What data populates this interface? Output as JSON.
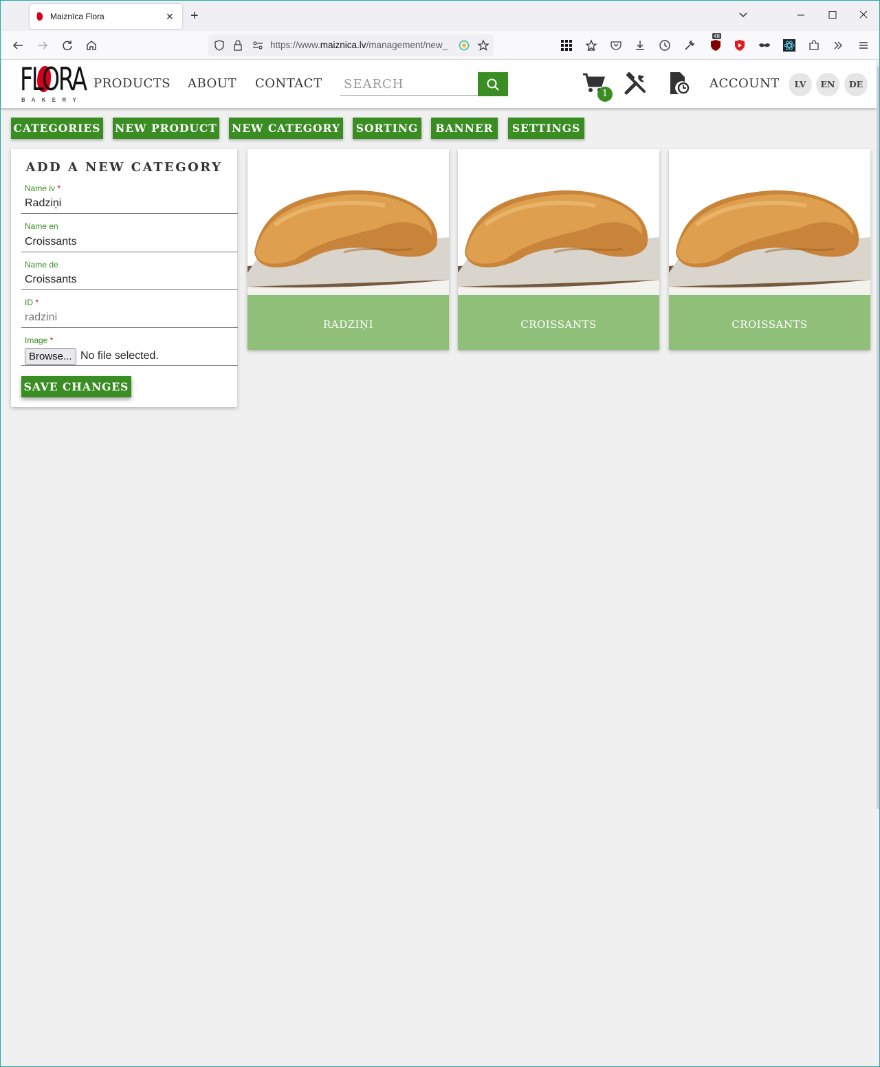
{
  "browser": {
    "tab_title": "Maiznīca Flora",
    "url_prefix": "https://www.",
    "url_domain": "maiznica.lv",
    "url_path": "/management/new_",
    "extension_badge": "48"
  },
  "header": {
    "logo_text": "FLORA",
    "logo_subtitle": "BAKERY",
    "nav": {
      "products": "PRODUCTS",
      "about": "ABOUT",
      "contact": "CONTACT",
      "account": "ACCOUNT"
    },
    "search_placeholder": "SEARCH",
    "cart_count": "1",
    "languages": [
      "LV",
      "EN",
      "DE"
    ]
  },
  "admin_menu": [
    "CATEGORIES",
    "NEW PRODUCT",
    "NEW CATEGORY",
    "SORTING",
    "BANNER",
    "SETTINGS"
  ],
  "form": {
    "title": "ADD A NEW CATEGORY",
    "fields": [
      {
        "label": "Name lv",
        "required": "*",
        "value": "Radziņi"
      },
      {
        "label": "Name en",
        "required": "",
        "value": "Croissants"
      },
      {
        "label": "Name de",
        "required": "",
        "value": "Croissants"
      },
      {
        "label": "ID",
        "required": "*",
        "value": "radzini"
      }
    ],
    "image_label": "Image",
    "image_required": "*",
    "browse_label": "Browse...",
    "file_status": "No file selected.",
    "save_label": "SAVE CHANGES"
  },
  "categories": [
    {
      "name": "RADZIŅI"
    },
    {
      "name": "CROISSANTS"
    },
    {
      "name": "CROISSANTS"
    }
  ],
  "colors": {
    "brand_green": "#3a8d22",
    "card_label_green": "#8fbf78",
    "logo_red": "#d6001c"
  }
}
